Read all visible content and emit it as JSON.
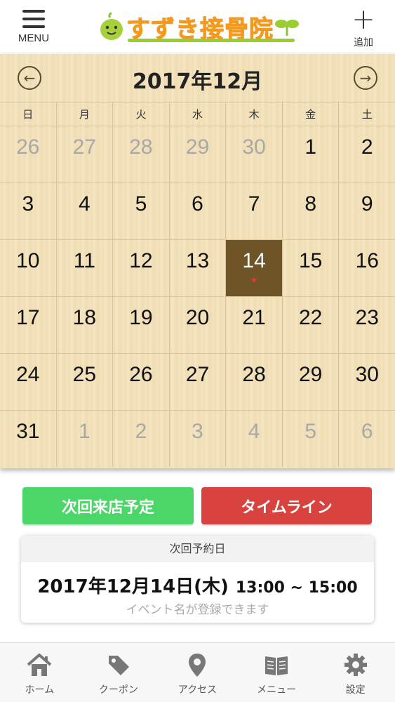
{
  "header": {
    "menu_label": "MENU",
    "logo_text": "すずき接骨院",
    "add_label": "追加",
    "logo_color": "#f39a1e"
  },
  "calendar": {
    "title": "2017年12月",
    "prev_icon": "arrow-left-circle",
    "next_icon": "arrow-right-circle",
    "weekdays": [
      "日",
      "月",
      "火",
      "水",
      "木",
      "金",
      "土"
    ],
    "weeks": [
      [
        {
          "n": "26",
          "m": true
        },
        {
          "n": "27",
          "m": true
        },
        {
          "n": "28",
          "m": true
        },
        {
          "n": "29",
          "m": true
        },
        {
          "n": "30",
          "m": true
        },
        {
          "n": "1"
        },
        {
          "n": "2"
        }
      ],
      [
        {
          "n": "3"
        },
        {
          "n": "4"
        },
        {
          "n": "5"
        },
        {
          "n": "6"
        },
        {
          "n": "7"
        },
        {
          "n": "8"
        },
        {
          "n": "9"
        }
      ],
      [
        {
          "n": "10"
        },
        {
          "n": "11"
        },
        {
          "n": "12"
        },
        {
          "n": "13"
        },
        {
          "n": "14",
          "today": true,
          "mark": "★"
        },
        {
          "n": "15"
        },
        {
          "n": "16"
        }
      ],
      [
        {
          "n": "17"
        },
        {
          "n": "18"
        },
        {
          "n": "19"
        },
        {
          "n": "20"
        },
        {
          "n": "21"
        },
        {
          "n": "22"
        },
        {
          "n": "23"
        }
      ],
      [
        {
          "n": "24"
        },
        {
          "n": "25"
        },
        {
          "n": "26"
        },
        {
          "n": "27"
        },
        {
          "n": "28"
        },
        {
          "n": "29"
        },
        {
          "n": "30"
        }
      ],
      [
        {
          "n": "31"
        },
        {
          "n": "1",
          "m": true
        },
        {
          "n": "2",
          "m": true
        },
        {
          "n": "3",
          "m": true
        },
        {
          "n": "4",
          "m": true
        },
        {
          "n": "5",
          "m": true
        },
        {
          "n": "6",
          "m": true
        }
      ]
    ],
    "today_color": "#6e5426",
    "mark_color": "#e23c3c"
  },
  "actions": {
    "next_visit_label": "次回来店予定",
    "timeline_label": "タイムライン",
    "next_visit_color": "#4cd66a",
    "timeline_color": "#d9433f"
  },
  "reservation": {
    "heading": "次回予約日",
    "date": "2017年12月14日(木)",
    "time": "13:00 ~ 15:00",
    "event_placeholder": "イベント名が登録できます"
  },
  "tabs": [
    {
      "label": "ホーム",
      "icon": "home-icon"
    },
    {
      "label": "クーポン",
      "icon": "tag-icon"
    },
    {
      "label": "アクセス",
      "icon": "map-pin-icon"
    },
    {
      "label": "メニュー",
      "icon": "book-icon"
    },
    {
      "label": "設定",
      "icon": "gear-icon"
    }
  ]
}
